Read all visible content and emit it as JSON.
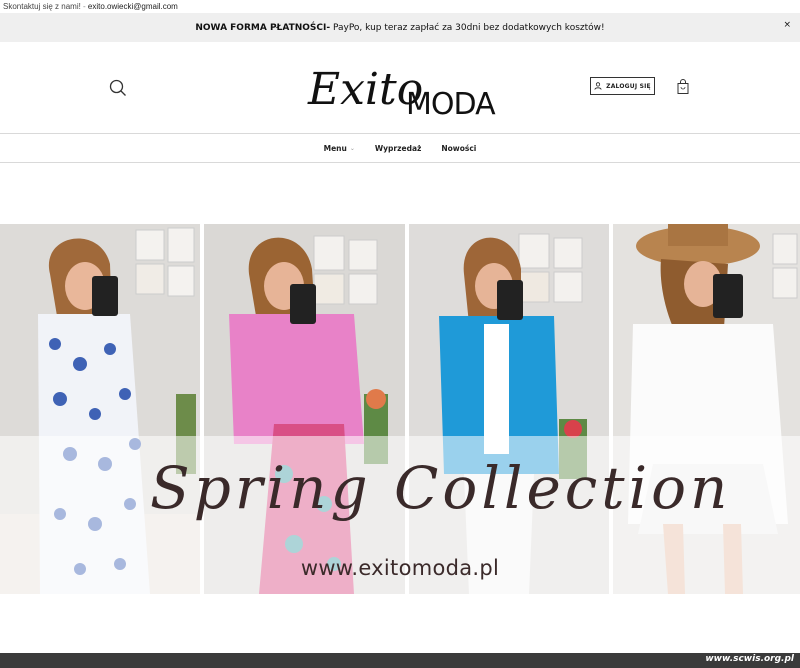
{
  "topbar": {
    "contact_label": "Skontaktuj się z nami!",
    "separator": " - ",
    "email": "exito.owiecki@gmail.com"
  },
  "promo": {
    "prefix": "NOWA FORMA PŁATNOŚCI-",
    "text": " PayPo, kup teraz zapłać za 30dni bez dodatkowych kosztów!",
    "close": "×"
  },
  "header": {
    "logo_script": "Exito",
    "logo_word": "MODA",
    "login_label": "ZALOGUJ SIĘ",
    "search_icon": "search-icon",
    "cart_icon": "shopping-bag-icon",
    "user_icon": "user-icon"
  },
  "nav": {
    "items": [
      {
        "label": "Menu",
        "has_dropdown": true
      },
      {
        "label": "Wyprzedaż",
        "has_dropdown": false
      },
      {
        "label": "Nowości",
        "has_dropdown": false
      }
    ]
  },
  "banner": {
    "title": "Spring Collection",
    "url": "www.exitomoda.pl"
  },
  "footer": {
    "watermark": "www.scwis.org.pl"
  },
  "colors": {
    "promo_bg": "#efefef",
    "footer_bg": "#3b3b3b",
    "banner_text": "#3a2a2a"
  }
}
